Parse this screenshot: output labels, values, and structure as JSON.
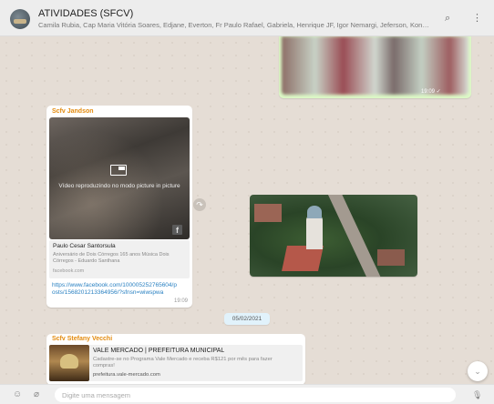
{
  "header": {
    "title": "ATIVIDADES (SFCV)",
    "subtitle": "Camila Rubia, Cap Maria Vitória Soares, Edjane, Everton, Fr Paulo Rafael, Gabriela, Henrique JF, Igor Nemargi, Jeferson, Konody, Lucas, ..."
  },
  "icons": {
    "search": "⌕",
    "menu": "⋮",
    "forward": "↷",
    "facebook": "f",
    "scroll_down": "⌄",
    "emoji": "☺",
    "attach": "⌀",
    "mic": "🎙"
  },
  "messages": {
    "outgoing_image": {
      "time": "19:09 ✓"
    },
    "video_message": {
      "sender": "Scfv Jandson",
      "video_text": "Vídeo reproduzindo no modo picture in picture",
      "preview_title": "Paulo Cesar Santorsula",
      "preview_desc": "Aniversário de Dois Córregos 165 anos Música Dois Córregos - Eduardo Santhana",
      "preview_domain": "facebook.com",
      "link": "https://www.facebook.com/100005252765604/posts/1568201213364956/?sfnsn=wiwspwa",
      "time": "19:09"
    },
    "date_separator": "05/02/2021",
    "vale_message": {
      "sender": "Scfv Stefany Vecchi",
      "card_title": "VALE MERCADO | PREFEITURA MUNICIPAL",
      "card_desc": "Cadastre-se no Programa Vale Mercado e receba R$121 por mês para fazer compras!",
      "card_domain": "prefeitura.vale-mercado.com"
    }
  },
  "composer": {
    "placeholder": "Digite uma mensagem"
  },
  "colors": {
    "sender": "#e38b0f",
    "link": "#2a81c2",
    "outgoing_bubble": "#dcf8c6",
    "header_bg": "#ededed"
  }
}
